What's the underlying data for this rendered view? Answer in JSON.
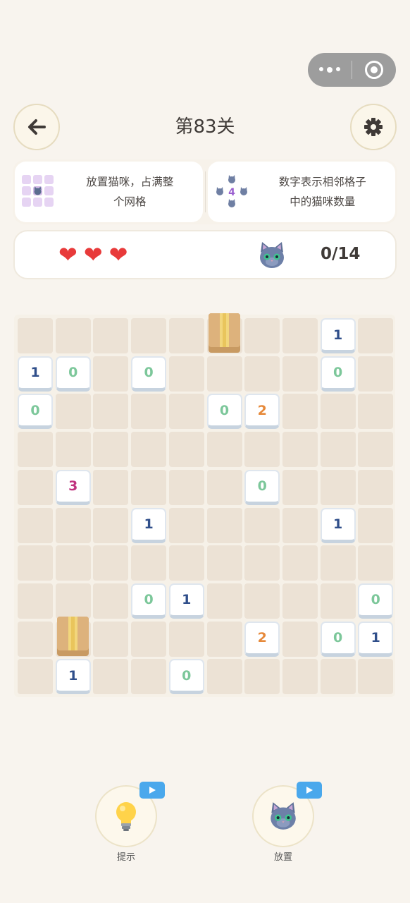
{
  "header": {
    "title": "第83关"
  },
  "rules": [
    {
      "lines": [
        "放置猫咪，占满整",
        "个网格"
      ],
      "icon": "grid-cat-icon"
    },
    {
      "lines": [
        "数字表示相邻格子",
        "中的猫咪数量"
      ],
      "icon": "adjacent-cats-icon",
      "icon_number": "4"
    }
  ],
  "status": {
    "lives": 3,
    "cat_count": "0/14"
  },
  "board": {
    "size": 10,
    "numbers": [
      {
        "r": 0,
        "c": 8,
        "v": "1"
      },
      {
        "r": 1,
        "c": 0,
        "v": "1"
      },
      {
        "r": 1,
        "c": 1,
        "v": "0"
      },
      {
        "r": 1,
        "c": 3,
        "v": "0"
      },
      {
        "r": 1,
        "c": 8,
        "v": "0"
      },
      {
        "r": 2,
        "c": 0,
        "v": "0"
      },
      {
        "r": 2,
        "c": 5,
        "v": "0"
      },
      {
        "r": 2,
        "c": 6,
        "v": "2"
      },
      {
        "r": 4,
        "c": 1,
        "v": "3"
      },
      {
        "r": 4,
        "c": 6,
        "v": "0"
      },
      {
        "r": 5,
        "c": 3,
        "v": "1"
      },
      {
        "r": 5,
        "c": 8,
        "v": "1"
      },
      {
        "r": 7,
        "c": 3,
        "v": "0"
      },
      {
        "r": 7,
        "c": 4,
        "v": "1"
      },
      {
        "r": 7,
        "c": 9,
        "v": "0"
      },
      {
        "r": 8,
        "c": 6,
        "v": "2"
      },
      {
        "r": 8,
        "c": 8,
        "v": "0"
      },
      {
        "r": 8,
        "c": 9,
        "v": "1"
      },
      {
        "r": 9,
        "c": 1,
        "v": "1"
      },
      {
        "r": 9,
        "c": 4,
        "v": "0"
      }
    ],
    "boxes": [
      {
        "r": 0,
        "c": 5
      },
      {
        "r": 8,
        "c": 1
      }
    ],
    "number_colors": {
      "0": "#7cc79a",
      "1": "#2f4e8a",
      "2": "#e6893a",
      "3": "#c0337e"
    }
  },
  "buttons": {
    "hint_label": "提示",
    "place_label": "放置"
  }
}
